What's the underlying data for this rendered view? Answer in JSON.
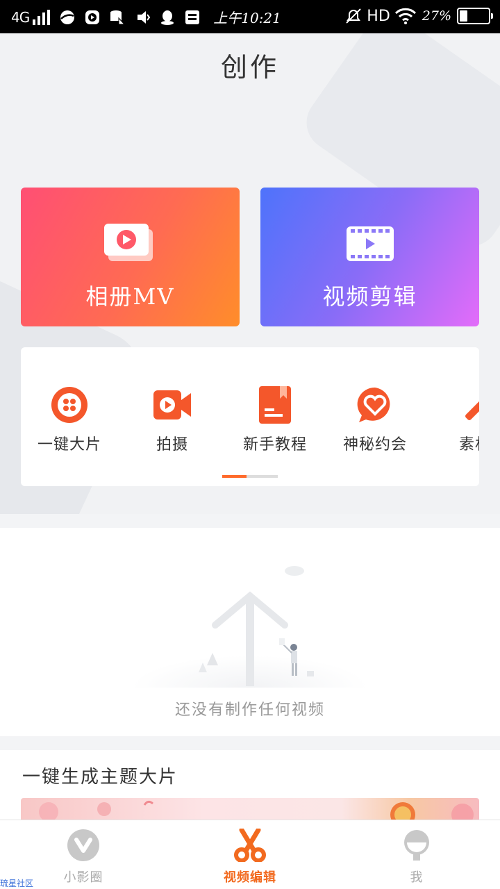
{
  "status_bar": {
    "network": "4G",
    "time": "上午10:21",
    "hd": "HD",
    "battery": "27%",
    "battery_level": 0.27
  },
  "page_title": "创作",
  "big_cards": [
    {
      "label": "相册MV",
      "icon": "photo-play-icon",
      "gradient": [
        "#ff4f74",
        "#ff8d2a"
      ]
    },
    {
      "label": "视频剪辑",
      "icon": "film-play-icon",
      "gradient": [
        "#4e73fb",
        "#e36cf9"
      ]
    }
  ],
  "tools": [
    {
      "label": "一键大片",
      "icon": "film-reel-icon"
    },
    {
      "label": "拍摄",
      "icon": "video-camera-icon"
    },
    {
      "label": "新手教程",
      "icon": "tutorial-book-icon"
    },
    {
      "label": "神秘约会",
      "icon": "heart-chat-icon"
    },
    {
      "label": "素材",
      "icon": "magic-wand-icon"
    }
  ],
  "pager": {
    "pages": 2,
    "active": 1
  },
  "empty_state": {
    "text": "还没有制作任何视频"
  },
  "theme_section": {
    "title": "一键生成主题大片"
  },
  "bottom_nav": [
    {
      "label": "小影圈",
      "icon": "community-icon",
      "active": false
    },
    {
      "label": "视频编辑",
      "icon": "scissors-icon",
      "active": true
    },
    {
      "label": "我",
      "icon": "profile-icon",
      "active": false
    }
  ],
  "watermark": "琉星社区",
  "colors": {
    "accent": "#f26a1f",
    "inactive": "#aaaaaa"
  }
}
